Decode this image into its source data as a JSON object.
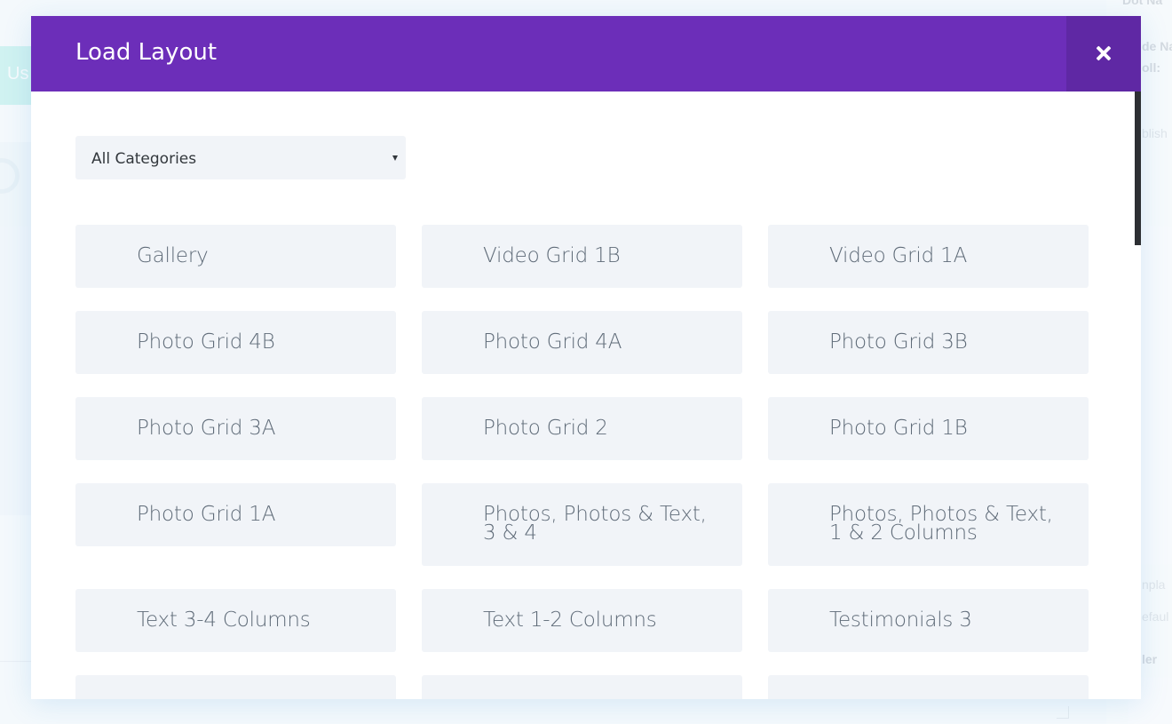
{
  "modal": {
    "title": "Load Layout",
    "close_label": "Close"
  },
  "filter": {
    "selected": "All Categories"
  },
  "layouts": [
    {
      "label": "Gallery"
    },
    {
      "label": "Video Grid 1B"
    },
    {
      "label": "Video Grid 1A"
    },
    {
      "label": "Photo Grid 4B"
    },
    {
      "label": "Photo Grid 4A"
    },
    {
      "label": "Photo Grid 3B"
    },
    {
      "label": "Photo Grid 3A"
    },
    {
      "label": "Photo Grid 2"
    },
    {
      "label": "Photo Grid 1B"
    },
    {
      "label": "Photo Grid 1A"
    },
    {
      "label": "Photos, Photos & Text, 3 & 4"
    },
    {
      "label": "Photos, Photos & Text, 1 & 2 Columns"
    },
    {
      "label": "Text 3-4 Columns"
    },
    {
      "label": "Text 1-2 Columns"
    },
    {
      "label": "Testimonials 3"
    },
    {
      "label": ""
    },
    {
      "label": ""
    },
    {
      "label": ""
    }
  ],
  "background": {
    "left_tab_text": "Us",
    "right_texts": [
      "Dot Na",
      "de Na",
      "oll:",
      "blish",
      "npla",
      "efaul",
      "ler"
    ]
  },
  "colors": {
    "header": "#6c2eb9",
    "close_button": "#5f28a4",
    "tile_background": "#f1f4f8"
  }
}
